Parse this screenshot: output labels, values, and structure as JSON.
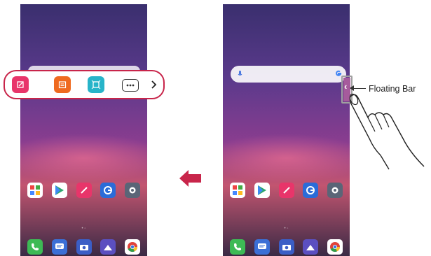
{
  "callout": {
    "label": "Floating Bar"
  },
  "apps": [
    {
      "name": "folder",
      "color": "#ffffff"
    },
    {
      "name": "play-store",
      "color": "#ffffff"
    },
    {
      "name": "notes",
      "color": "#e8356a"
    },
    {
      "name": "browser",
      "color": "#2b6cd8"
    },
    {
      "name": "settings",
      "color": "#5a6577"
    }
  ],
  "dock": [
    {
      "name": "phone",
      "color": "#3dba55"
    },
    {
      "name": "messages",
      "color": "#3b6fd6"
    },
    {
      "name": "camera",
      "color": "#3b5ec6"
    },
    {
      "name": "gallery",
      "color": "#5b4fc0"
    },
    {
      "name": "chrome",
      "color": "#ffffff"
    }
  ],
  "floating_bar": [
    {
      "name": "qmemo",
      "color": "#e8356a"
    },
    {
      "name": "calendar",
      "color": "#ef6a1f"
    },
    {
      "name": "screen-capture",
      "color": "#27b4c9"
    },
    {
      "name": "more",
      "color": "#ffffff"
    }
  ],
  "colors": {
    "highlight": "#c8254a",
    "arrow": "#c8254a"
  }
}
